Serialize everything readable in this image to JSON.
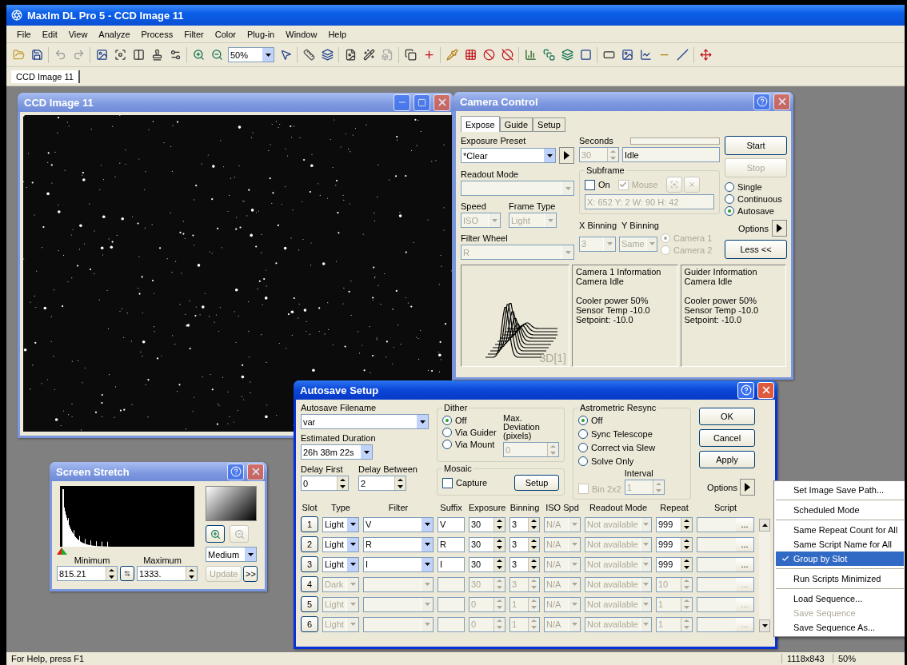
{
  "app_title": "MaxIm DL Pro 5 - CCD Image 11",
  "menu": [
    "File",
    "Edit",
    "View",
    "Analyze",
    "Process",
    "Filter",
    "Color",
    "Plug-in",
    "Window",
    "Help"
  ],
  "toolbar": {
    "zoom": "50%"
  },
  "document_tabs": [
    {
      "label": "CCD Image 11",
      "selected": true
    }
  ],
  "image_window": {
    "title": "CCD Image 11",
    "active": false
  },
  "camera_control": {
    "title": "Camera Control",
    "active": false,
    "tabs": [
      {
        "label": "Expose",
        "selected": true
      },
      {
        "label": "Guide",
        "selected": false
      },
      {
        "label": "Setup",
        "selected": false
      }
    ],
    "exposure_preset_label": "Exposure Preset",
    "exposure_preset": "*Clear",
    "readout_mode_label": "Readout Mode",
    "speed_label": "Speed",
    "speed": "ISO",
    "frame_type_label": "Frame Type",
    "frame_type": "Light",
    "filter_wheel_label": "Filter Wheel",
    "filter": "R",
    "seconds_label": "Seconds",
    "seconds": "30",
    "status": "Idle",
    "subframe": {
      "label": "Subframe",
      "checks": [
        {
          "label": "On",
          "checked": false,
          "disabled": false
        },
        {
          "label": "Mouse",
          "checked": true,
          "disabled": true
        }
      ],
      "coords": "X: 652 Y:   2 W:   90 H:   42"
    },
    "x_binning_label": "X Binning",
    "y_binning_label": "Y Binning",
    "x_binning": "3",
    "y_binning": "Same",
    "cameras": [
      {
        "label": "Camera 1",
        "selected": true
      },
      {
        "label": "Camera 2",
        "selected": false
      }
    ],
    "buttons": [
      {
        "label": "Start",
        "disabled": false
      },
      {
        "label": "Stop",
        "disabled": true
      }
    ],
    "modes": [
      {
        "label": "Single",
        "selected": false
      },
      {
        "label": "Continuous",
        "selected": false
      },
      {
        "label": "Autosave",
        "selected": true
      }
    ],
    "options_label": "Options",
    "less_button": "Less <<",
    "plot_label": "3D[1]",
    "progress": {
      "level": 0
    },
    "info": [
      [
        [
          "Camera 1 Information",
          "Camera Idle"
        ],
        [
          "Cooler power 50%",
          "Sensor Temp -10.0",
          "Setpoint: -10.0"
        ]
      ],
      [
        [
          "Guider Information",
          "Camera Idle"
        ],
        [
          "Cooler power 50%",
          "Sensor Temp -10.0",
          "Setpoint: -10.0"
        ]
      ]
    ]
  },
  "autosave": {
    "title": "Autosave Setup",
    "active": true,
    "filename_label": "Autosave Filename",
    "filename": "var",
    "duration_label": "Estimated Duration",
    "duration": "26h 38m 22s",
    "delay_first_label": "Delay First",
    "delay_first": "0",
    "delay_between_label": "Delay Between",
    "delay_between": "2",
    "dither": {
      "label": "Dither",
      "options": [
        {
          "label": "Off",
          "selected": true
        },
        {
          "label": "Via Guider",
          "selected": false
        },
        {
          "label": "Via Mount",
          "selected": false
        }
      ],
      "deviation_label": "Max. Deviation (pixels)",
      "deviation": "0"
    },
    "mosaic": {
      "label": "Mosaic",
      "capture": {
        "label": "Capture",
        "checked": false
      },
      "setup_button": "Setup"
    },
    "astrometric": {
      "label": "Astrometric Resync",
      "options": [
        {
          "label": "Off",
          "selected": true
        },
        {
          "label": "Sync Telescope",
          "selected": false
        },
        {
          "label": "Correct via Slew",
          "selected": false
        },
        {
          "label": "Solve Only",
          "selected": false
        }
      ],
      "bin": {
        "label": "Bin 2x2",
        "checked": false
      },
      "interval_label": "Interval",
      "interval": "1"
    },
    "buttons": [
      "OK",
      "Cancel",
      "Apply"
    ],
    "options_label": "Options",
    "columns": [
      "Slot",
      "Type",
      "Filter",
      "Suffix",
      "Exposure",
      "Binning",
      "ISO Spd",
      "Readout Mode",
      "Repeat",
      "Script"
    ],
    "rows": [
      {
        "slot": "1",
        "type": "Light",
        "filter": "V",
        "suffix": "V",
        "exposure": "30",
        "binning": "3",
        "iso": "N/A",
        "readout": "Not available",
        "repeat": "999",
        "browse": "...",
        "enabled": true
      },
      {
        "slot": "2",
        "type": "Light",
        "filter": "R",
        "suffix": "R",
        "exposure": "30",
        "binning": "3",
        "iso": "N/A",
        "readout": "Not available",
        "repeat": "999",
        "browse": "...",
        "enabled": true
      },
      {
        "slot": "3",
        "type": "Light",
        "filter": "I",
        "suffix": "I",
        "exposure": "30",
        "binning": "3",
        "iso": "N/A",
        "readout": "Not available",
        "repeat": "999",
        "browse": "...",
        "enabled": true
      },
      {
        "slot": "4",
        "type": "Dark",
        "filter": "",
        "suffix": "",
        "exposure": "30",
        "binning": "3",
        "iso": "N/A",
        "readout": "Not available",
        "repeat": "10",
        "browse": "...",
        "enabled": false
      },
      {
        "slot": "5",
        "type": "Light",
        "filter": "",
        "suffix": "",
        "exposure": "0",
        "binning": "1",
        "iso": "N/A",
        "readout": "Not available",
        "repeat": "1",
        "browse": "...",
        "enabled": false
      },
      {
        "slot": "6",
        "type": "Light",
        "filter": "",
        "suffix": "",
        "exposure": "0",
        "binning": "1",
        "iso": "N/A",
        "readout": "Not available",
        "repeat": "1",
        "browse": "...",
        "enabled": false
      }
    ]
  },
  "screen_stretch": {
    "title": "Screen Stretch",
    "active": false,
    "minimum_label": "Minimum",
    "maximum_label": "Maximum",
    "minimum": "815.21",
    "maximum": "1333.",
    "mode": "Medium",
    "update_button": "Update",
    "update_disabled": true,
    "more_button": ">>"
  },
  "options_menu": [
    [
      {
        "label": "Set Image Save Path...",
        "checked": false,
        "disabled": false,
        "selected": false
      }
    ],
    [
      {
        "label": "Scheduled Mode",
        "checked": false,
        "disabled": false,
        "selected": false
      }
    ],
    [
      {
        "label": "Same Repeat Count for All",
        "checked": false,
        "disabled": false,
        "selected": false
      },
      {
        "label": "Same Script Name for All",
        "checked": false,
        "disabled": false,
        "selected": false
      },
      {
        "label": "Group by Slot",
        "checked": true,
        "disabled": false,
        "selected": true
      }
    ],
    [
      {
        "label": "Run Scripts Minimized",
        "checked": false,
        "disabled": false,
        "selected": false
      }
    ],
    [
      {
        "label": "Load Sequence...",
        "checked": false,
        "disabled": false,
        "selected": false
      },
      {
        "label": "Save Sequence",
        "checked": false,
        "disabled": true,
        "selected": false
      },
      {
        "label": "Save Sequence As...",
        "checked": false,
        "disabled": false,
        "selected": false
      }
    ]
  ],
  "status_bar": [
    "For Help, press F1",
    "1118x843",
    "50%"
  ]
}
